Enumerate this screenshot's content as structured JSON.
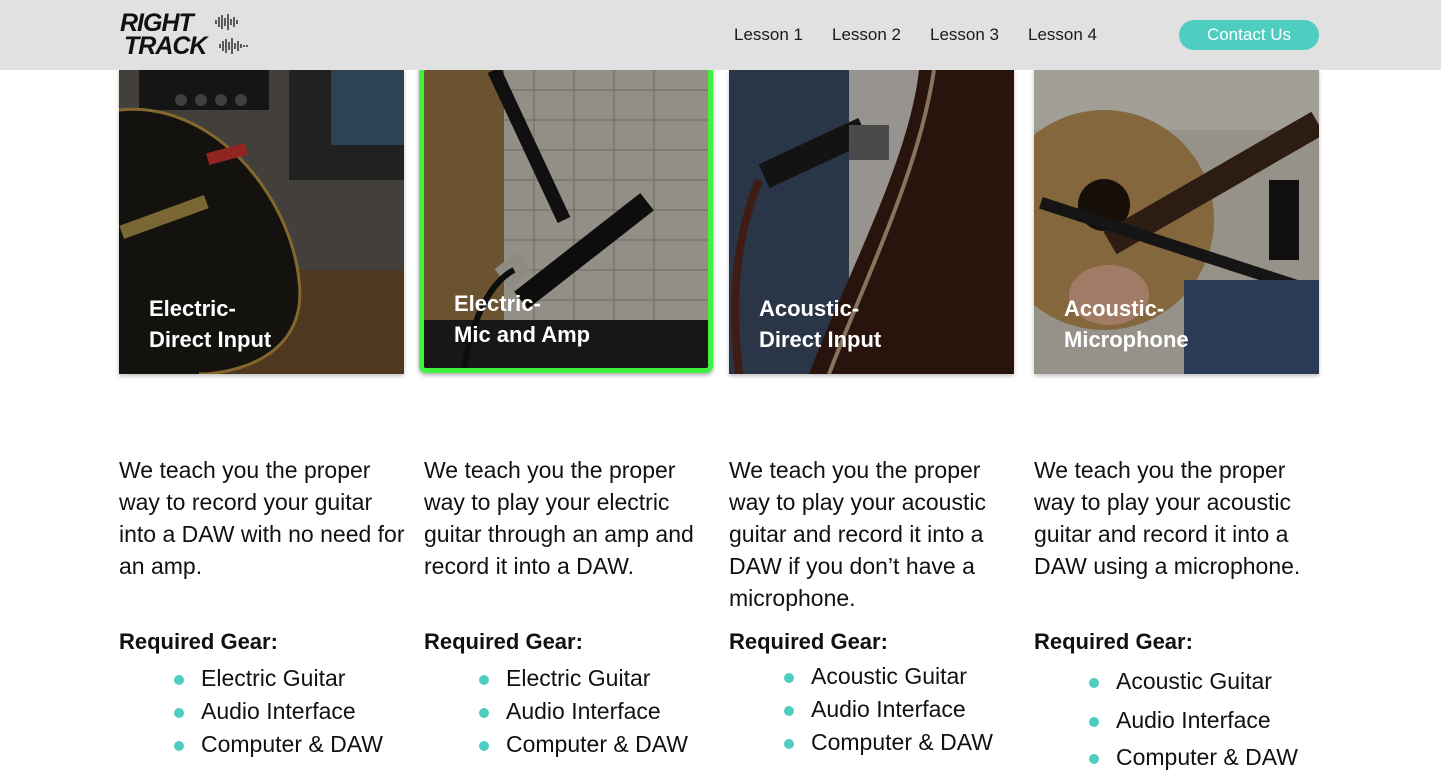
{
  "brand": {
    "line1": "RIGHT",
    "line2": "TRACK"
  },
  "nav": {
    "items": [
      "Lesson 1",
      "Lesson 2",
      "Lesson 3",
      "Lesson 4"
    ],
    "contact": "Contact Us"
  },
  "accent_color": "#4ecdc0",
  "selected_color": "#3ff23f",
  "cards": [
    {
      "title1": "Electric-",
      "title2": "Direct Input",
      "selected": false
    },
    {
      "title1": "Electric-",
      "title2": "Mic and Amp",
      "selected": true
    },
    {
      "title1": "Acoustic-",
      "title2": "Direct Input",
      "selected": false
    },
    {
      "title1": "Acoustic-",
      "title2": "Microphone",
      "selected": false
    }
  ],
  "lessons": [
    {
      "description": "We teach you the proper way to record your guitar into a DAW with no need for an amp.",
      "gear_heading": "Required Gear:",
      "gear": [
        "Electric Guitar",
        "Audio Interface",
        "Computer & DAW"
      ]
    },
    {
      "description": "We teach you the proper way to play your electric guitar through an amp and record it into a DAW.",
      "gear_heading": "Required Gear:",
      "gear": [
        "Electric Guitar",
        "Audio Interface",
        "Computer & DAW"
      ]
    },
    {
      "description": "We teach you the proper way to play your acoustic guitar and record it into a DAW if you don’t have a microphone.",
      "gear_heading": "Required Gear:",
      "gear": [
        "Acoustic Guitar",
        "Audio Interface",
        "Computer & DAW"
      ]
    },
    {
      "description": "We teach you the proper way to play your acoustic guitar and record it into a DAW using a microphone.",
      "gear_heading": "Required Gear:",
      "gear": [
        "Acoustic Guitar",
        "Audio Interface",
        "Computer & DAW"
      ]
    }
  ]
}
